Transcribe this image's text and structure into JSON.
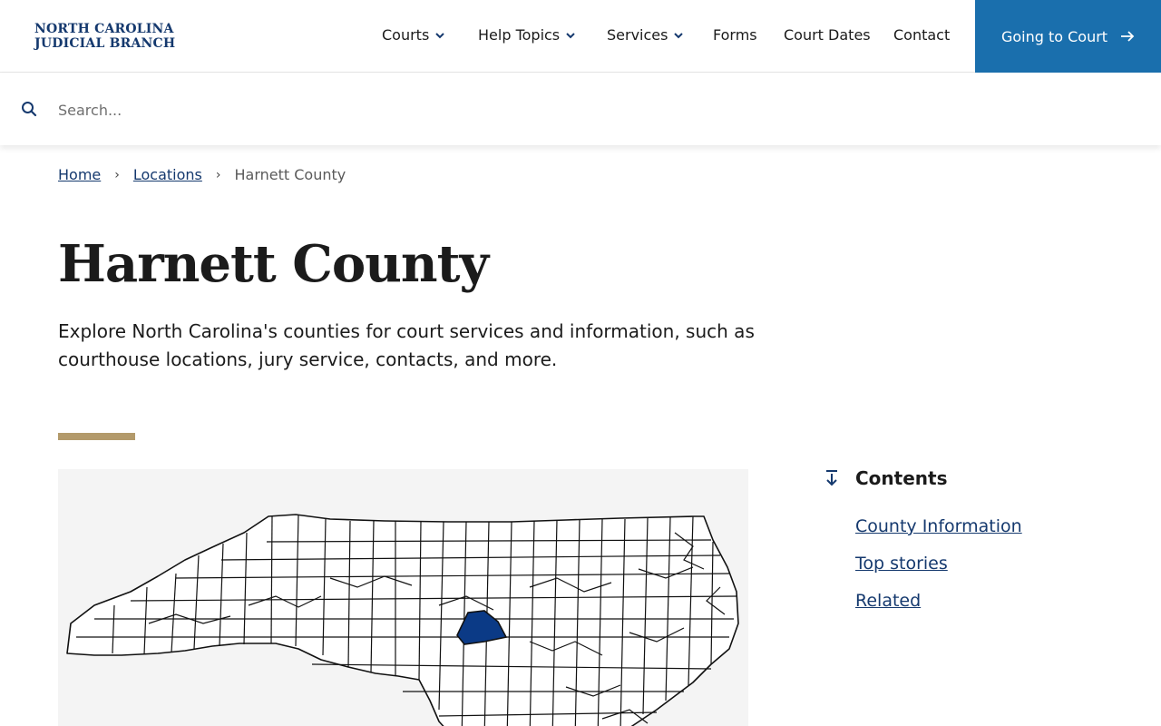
{
  "logo": {
    "line1": "NORTH CAROLINA",
    "line2": "JUDICIAL BRANCH"
  },
  "nav": {
    "items": [
      {
        "label": "Courts",
        "has_menu": true
      },
      {
        "label": "Help Topics",
        "has_menu": true
      },
      {
        "label": "Services",
        "has_menu": true
      },
      {
        "label": "Forms",
        "has_menu": false
      },
      {
        "label": "Court Dates",
        "has_menu": false
      },
      {
        "label": "Contact",
        "has_menu": false
      }
    ],
    "cta_label": "Going to Court"
  },
  "search": {
    "placeholder": "Search...",
    "value": ""
  },
  "breadcrumb": {
    "home": "Home",
    "locations": "Locations",
    "current": "Harnett County"
  },
  "main": {
    "title": "Harnett County",
    "intro": "Explore North Carolina's counties for court services and information, such as courthouse locations, jury service, contacts, and more."
  },
  "toc": {
    "heading": "Contents",
    "items": [
      "County Information",
      "Top stories",
      "Related"
    ]
  },
  "colors": {
    "brand_navy": "#15396e",
    "cta_blue": "#1a6fad",
    "accent_tan": "#b39a6b",
    "highlight_county": "#0b3a86"
  },
  "icons": {
    "search": "search-icon",
    "chevron": "chevron-down-icon",
    "arrow": "arrow-right-icon",
    "contents": "arrow-down-to-line-icon"
  }
}
